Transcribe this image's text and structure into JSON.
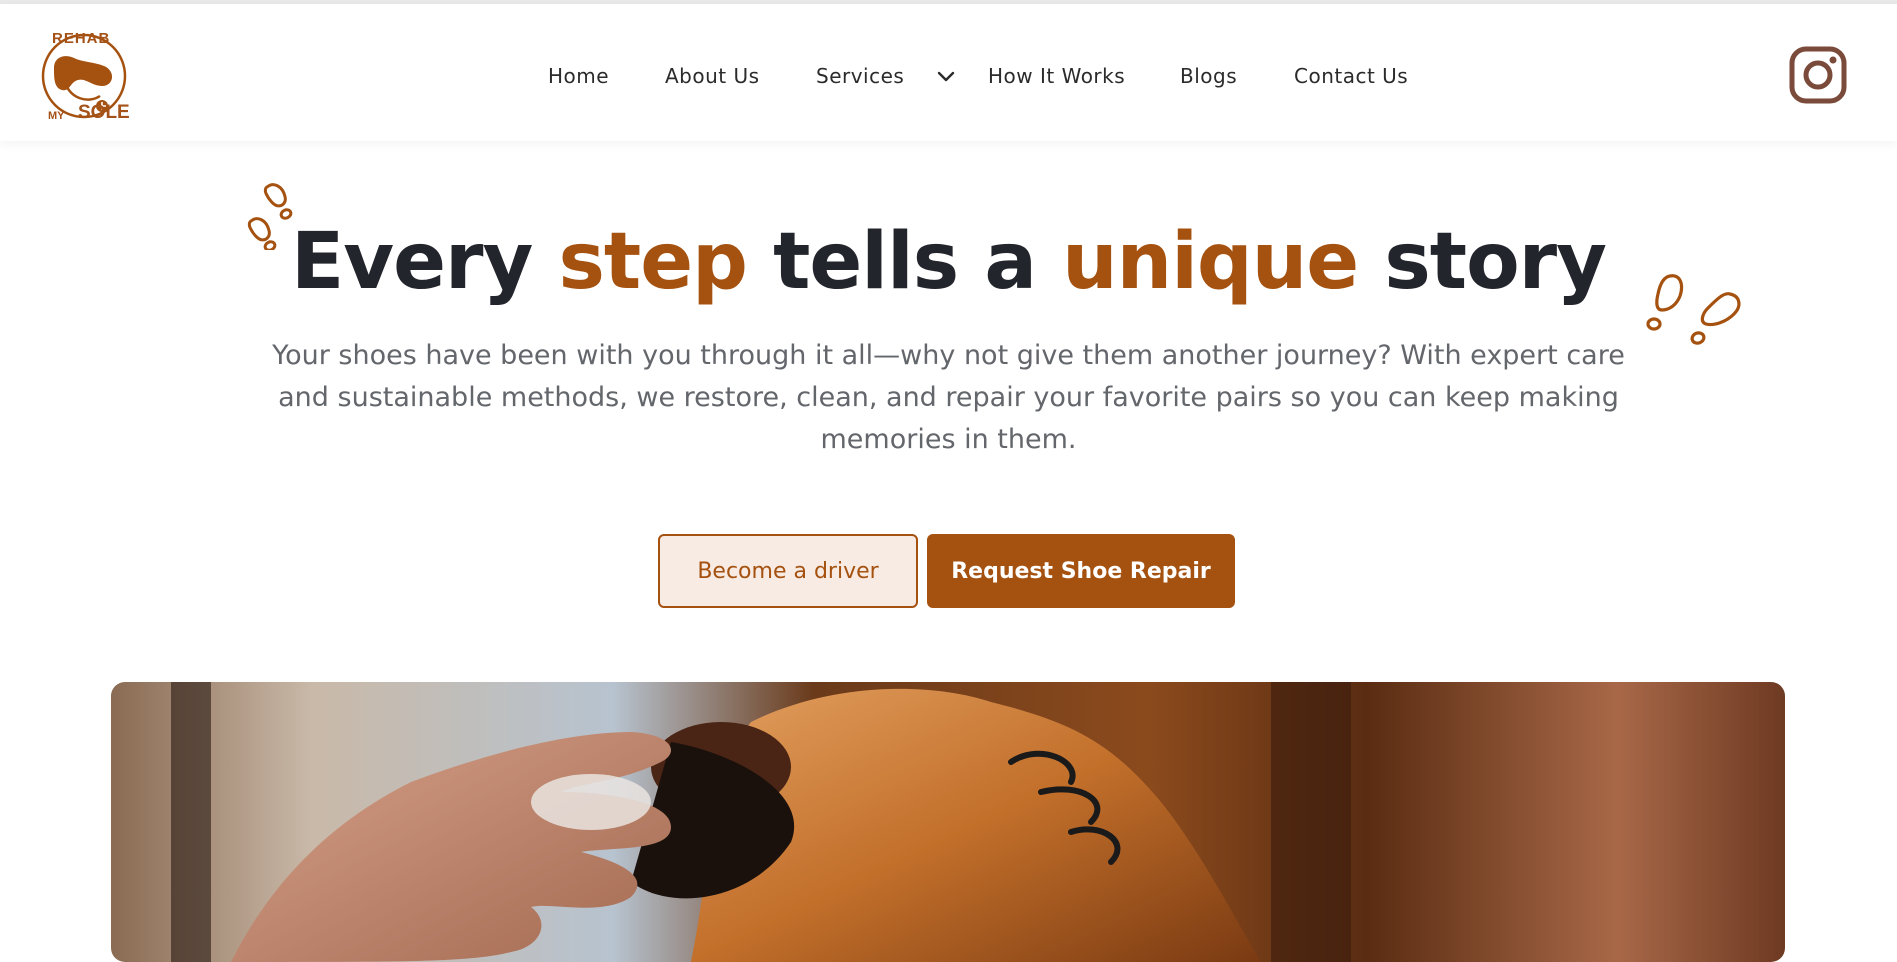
{
  "brand": {
    "logo_top_text": "REHAB",
    "logo_bottom_left": "MY",
    "logo_bottom_right": "SOLE",
    "accent_color": "#a5510f"
  },
  "nav": {
    "items": [
      {
        "label": "Home"
      },
      {
        "label": "About Us"
      },
      {
        "label": "Services"
      },
      {
        "label": "How It Works"
      },
      {
        "label": "Blogs"
      },
      {
        "label": "Contact Us"
      }
    ],
    "social_icon": "instagram-icon"
  },
  "hero": {
    "title_parts": [
      "Every ",
      "step",
      " tells a ",
      "unique",
      " story"
    ],
    "subtitle": "Your shoes have been with you through it all—why not give them another journey? With expert care and sustainable methods, we restore, clean, and repair your favorite pairs so you can keep making memories in them.",
    "secondary_button": "Become a driver",
    "primary_button": "Request Shoe Repair"
  }
}
